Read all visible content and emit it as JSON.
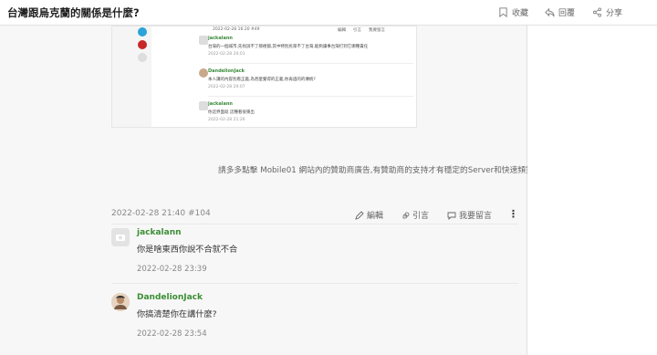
{
  "header": {
    "title": "台灣跟烏克蘭的關係是什麼?",
    "actions": [
      {
        "label": "收藏",
        "icon": "bookmark-icon"
      },
      {
        "label": "回覆",
        "icon": "reply-icon"
      },
      {
        "label": "分享",
        "icon": "share-icon"
      }
    ]
  },
  "embed": {
    "top_date": "2022-02-28 16:20 #49",
    "top_actions": [
      "編輯",
      "引言",
      "我要留言"
    ],
    "comments": [
      {
        "user": "jackalann",
        "text": "台灣的一個城市,先找說不了那裡都,其中特別民眾不了台灣,能夠讓事台灣打到它哪種責任",
        "date": "2022-02-28 20:01"
      },
      {
        "user": "DandelionJack",
        "text": "本人講的內容別看正義,為甚麼覺得的正義,你再過的的傳統?",
        "date": "2022-02-28 20:07"
      },
      {
        "user": "jackalann",
        "text": "你這界面就 這種看很東出",
        "date": "2022-02-28 21:26"
      }
    ]
  },
  "sponsor_text": "請多多點擊 Mobile01 網站內的贊助商廣告,有贊助商的支持才有穩定的Server和快速頻寬。",
  "post": {
    "meta": "2022-02-28 21:40 #104",
    "actions": {
      "edit": "編輯",
      "quote": "引言",
      "comment": "我要留言"
    },
    "more": "⋮"
  },
  "comments": [
    {
      "user": "jackalann",
      "text": "你是啥東西你說不合就不合",
      "date": "2022-02-28 23:39"
    },
    {
      "user": "DandelionJack",
      "text": "你搞清楚你在講什麼?",
      "date": "2022-02-28 23:54"
    }
  ],
  "colors": {
    "username": "#3b8e34",
    "background": "#f7f7f7"
  }
}
